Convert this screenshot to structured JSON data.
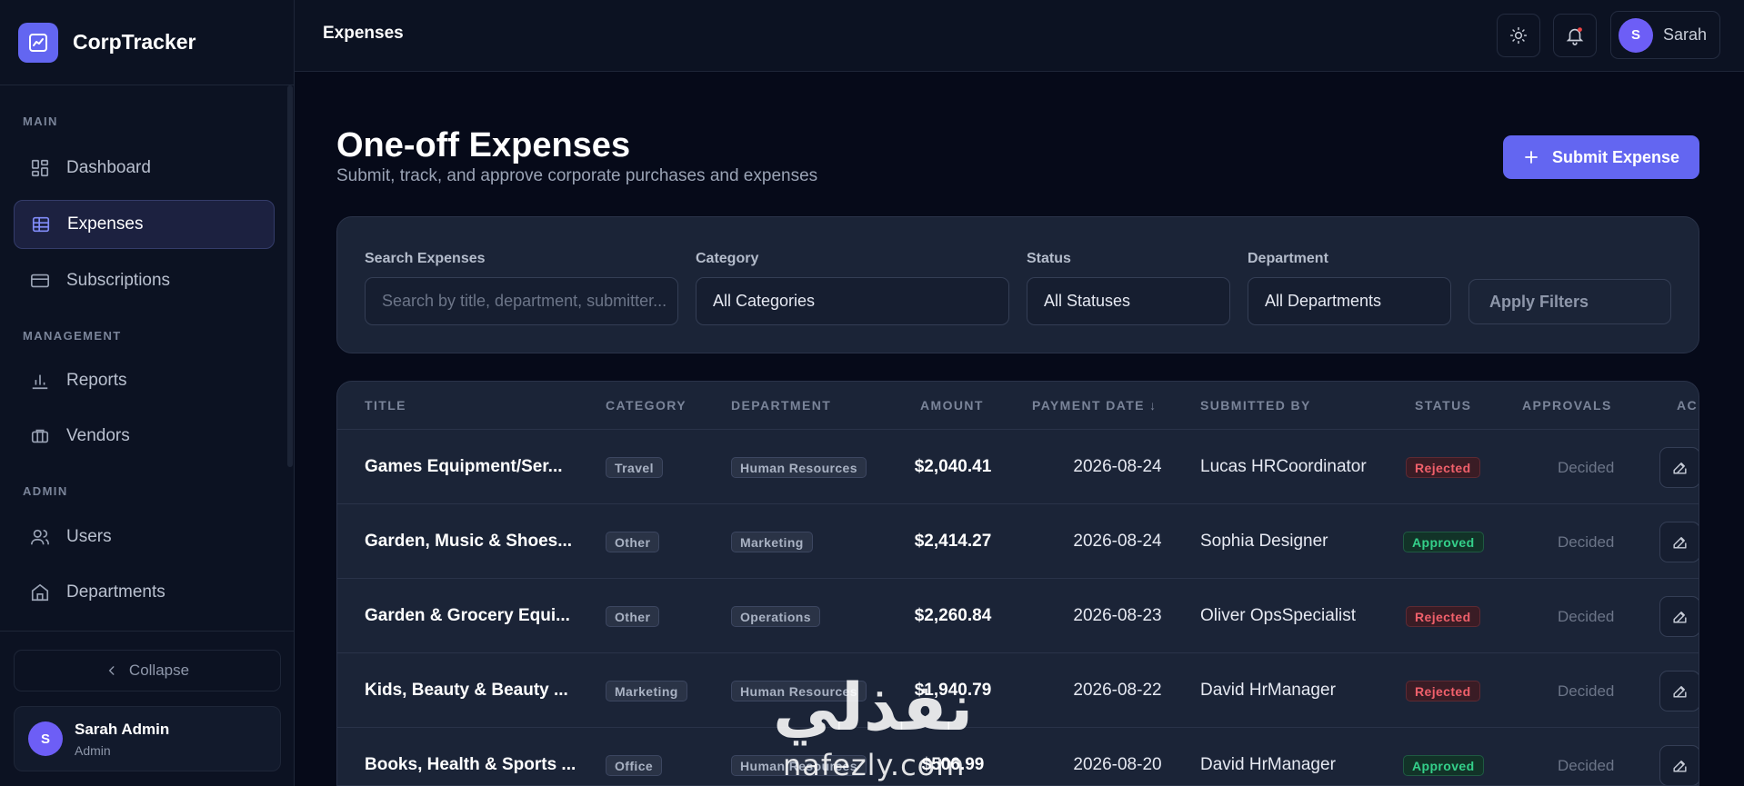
{
  "app": {
    "name": "CorpTracker"
  },
  "sidebar": {
    "sections": {
      "main": "MAIN",
      "management": "MANAGEMENT",
      "admin": "ADMIN"
    },
    "items": [
      {
        "label": "Dashboard",
        "icon": "grid-icon"
      },
      {
        "label": "Expenses",
        "icon": "table-icon",
        "active": true
      },
      {
        "label": "Subscriptions",
        "icon": "card-icon"
      },
      {
        "label": "Reports",
        "icon": "bar-chart-icon"
      },
      {
        "label": "Vendors",
        "icon": "shop-icon"
      },
      {
        "label": "Users",
        "icon": "users-icon"
      },
      {
        "label": "Departments",
        "icon": "building-icon"
      }
    ],
    "collapse_label": "Collapse",
    "user": {
      "initial": "S",
      "name": "Sarah Admin",
      "role": "Admin"
    }
  },
  "topbar": {
    "title": "Expenses",
    "user_initial": "S",
    "user_name": "Sarah"
  },
  "page": {
    "title": "One-off Expenses",
    "subtitle": "Submit, track, and approve corporate purchases and expenses",
    "submit_label": "Submit Expense"
  },
  "filters": {
    "search_label": "Search Expenses",
    "search_placeholder": "Search by title, department, submitter...",
    "category_label": "Category",
    "category_value": "All Categories",
    "status_label": "Status",
    "status_value": "All Statuses",
    "department_label": "Department",
    "department_value": "All Departments",
    "apply_label": "Apply Filters"
  },
  "table": {
    "columns": [
      "TITLE",
      "CATEGORY",
      "DEPARTMENT",
      "AMOUNT",
      "PAYMENT DATE ↓",
      "SUBMITTED BY",
      "STATUS",
      "APPROVALS",
      "AC"
    ],
    "rows": [
      {
        "title": "Games Equipment/Ser...",
        "category": "Travel",
        "department": "Human Resources",
        "amount": "$2,040.41",
        "date": "2026-08-24",
        "submitted_by": "Lucas HRCoordinator",
        "status": "Rejected",
        "approvals": "Decided"
      },
      {
        "title": "Garden, Music & Shoes...",
        "category": "Other",
        "department": "Marketing",
        "amount": "$2,414.27",
        "date": "2026-08-24",
        "submitted_by": "Sophia Designer",
        "status": "Approved",
        "approvals": "Decided"
      },
      {
        "title": "Garden & Grocery Equi...",
        "category": "Other",
        "department": "Operations",
        "amount": "$2,260.84",
        "date": "2026-08-23",
        "submitted_by": "Oliver OpsSpecialist",
        "status": "Rejected",
        "approvals": "Decided"
      },
      {
        "title": "Kids, Beauty & Beauty ...",
        "category": "Marketing",
        "department": "Human Resources",
        "amount": "$1,940.79",
        "date": "2026-08-22",
        "submitted_by": "David HrManager",
        "status": "Rejected",
        "approvals": "Decided"
      },
      {
        "title": "Books, Health & Sports ...",
        "category": "Office",
        "department": "Human Resources",
        "amount": "$506.99",
        "date": "2026-08-20",
        "submitted_by": "David HrManager",
        "status": "Approved",
        "approvals": "Decided"
      }
    ]
  },
  "watermark": {
    "arabic": "نفذلي",
    "latin": "nafezly.com"
  },
  "colors": {
    "accent": "#6366f1",
    "rejected": "#f0606b",
    "approved": "#34d08a",
    "background": "#060a19"
  }
}
